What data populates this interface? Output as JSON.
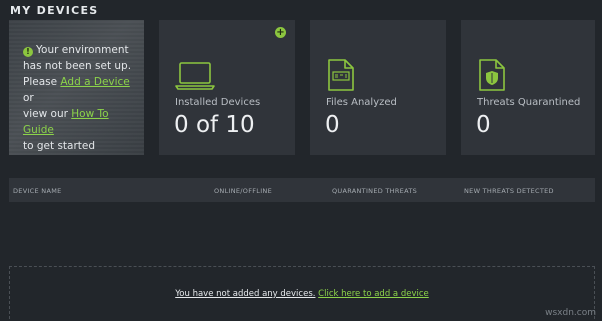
{
  "header": {
    "title": "MY DEVICES"
  },
  "setup": {
    "line1": "Your environment",
    "line2": "has not been set up.",
    "line3_pre": "Please ",
    "add_link": "Add a Device",
    "line3_post": " or",
    "line4_pre": "view our ",
    "guide_link": "How To Guide",
    "line5": "to get started"
  },
  "stats": [
    {
      "label": "Installed Devices",
      "value": "0 of 10",
      "icon": "laptop-icon"
    },
    {
      "label": "Files Analyzed",
      "value": "0",
      "icon": "file-icon"
    },
    {
      "label": "Threats Quarantined",
      "value": "0",
      "icon": "shield-file-icon"
    }
  ],
  "table": {
    "columns": [
      "DEVICE NAME",
      "ONLINE/OFFLINE",
      "QUARANTINED THREATS",
      "NEW THREATS DETECTED"
    ]
  },
  "empty": {
    "message": "You have not added any devices.",
    "link": "Click here to add a device"
  },
  "watermark": "wsxdn.com",
  "colors": {
    "accent": "#8cc63f",
    "card": "#30343a",
    "background": "#22262b"
  }
}
